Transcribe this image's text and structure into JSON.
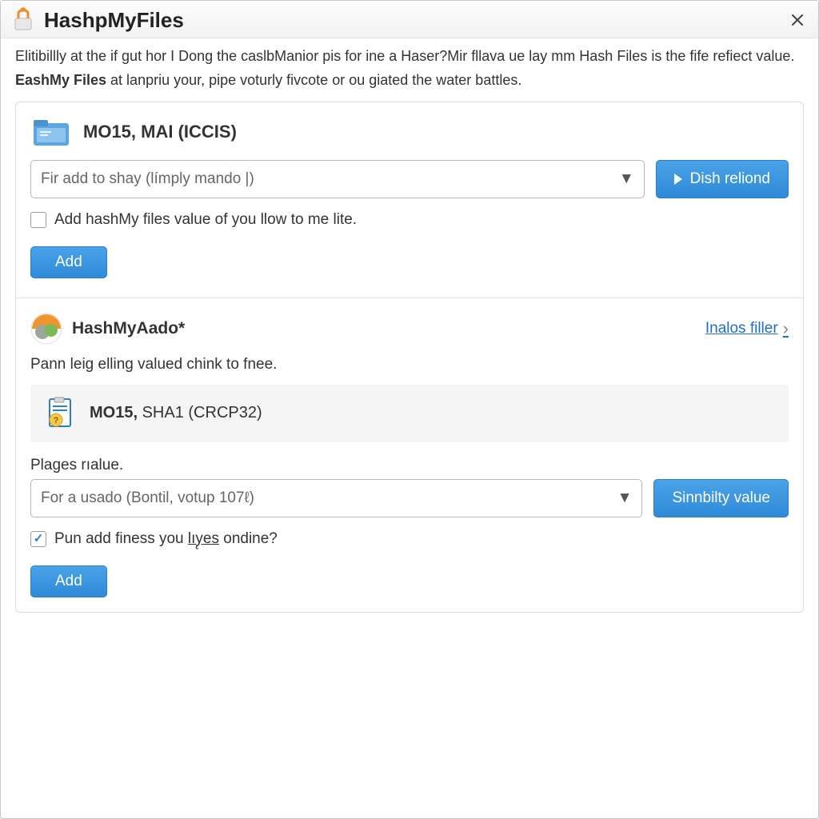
{
  "window": {
    "title": "HashpMyFiles"
  },
  "intro": {
    "line1_prefix": "Elitibillly at the if gut hor I Dong the caslbManior pis for ine a Haser?Mir fllava ue lay mm Hash Files is the fife refiect value.",
    "line2_bold": "EashMy Files",
    "line2_rest": " at lanpriu your, pipe voturly fivcote or ou giated the water battles."
  },
  "section1": {
    "title": "MO15, MAI (ICCIS)",
    "combo_placeholder": "Fir add to shay (límply mando |)",
    "action_button": "Dish reliond",
    "checkbox_label": "Add hashMy files value of you llow to me lite.",
    "checkbox_checked": false,
    "add_button": "Add"
  },
  "section2": {
    "title": "HashMyAado*",
    "link_label": "Inalos filler",
    "desc": "Pann leig elling valued chink to fnee.",
    "hash_label_bold": "MO15,",
    "hash_label_rest": " SHA1 (CRCP32)",
    "field_label": "Plages rıalue.",
    "combo_placeholder": "For a usado (Bontil, votup 107ℓ)",
    "action_button": "Sinnbilty value",
    "checkbox_label_pre": "Pun add finess you ",
    "checkbox_label_under": "lıy̨es",
    "checkbox_label_post": " ondine?",
    "checkbox_checked": true,
    "add_button": "Add"
  }
}
